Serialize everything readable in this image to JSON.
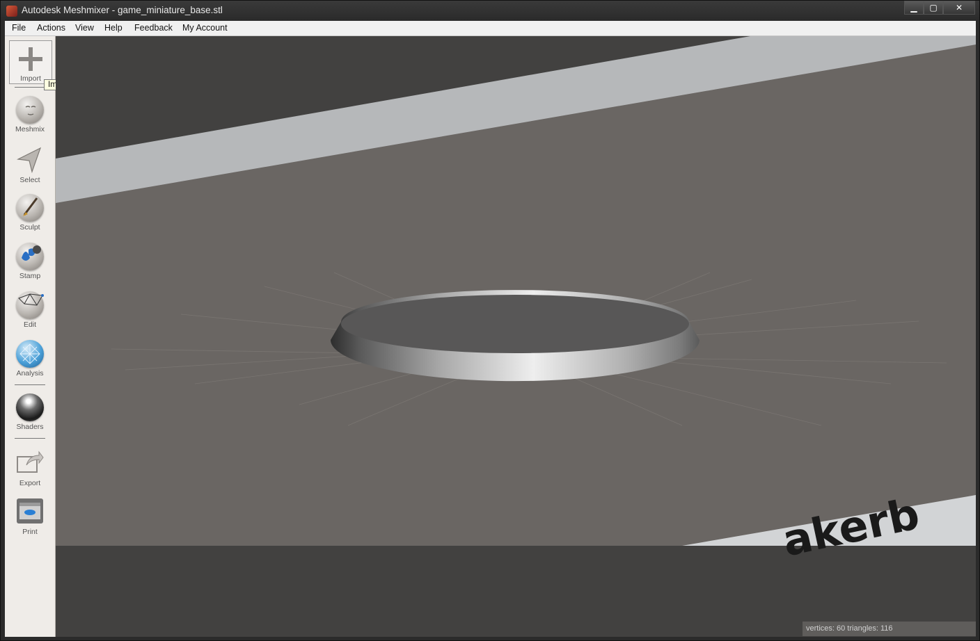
{
  "window": {
    "title": "Autodesk Meshmixer - game_miniature_base.stl",
    "buttons": {
      "minimize": "▁",
      "maximize": "▢",
      "close": "✕"
    }
  },
  "menu": {
    "items": [
      "File",
      "Actions",
      "View",
      "Help",
      "Feedback",
      "My Account"
    ]
  },
  "toolbar": {
    "tools": [
      {
        "label": "Import",
        "icon": "plus-icon"
      },
      {
        "label": "Meshmix",
        "icon": "face-ball-icon"
      },
      {
        "label": "Select",
        "icon": "arrow-icon"
      },
      {
        "label": "Sculpt",
        "icon": "brush-ball-icon"
      },
      {
        "label": "Stamp",
        "icon": "stamp-ball-icon"
      },
      {
        "label": "Edit",
        "icon": "mesh-ball-icon"
      },
      {
        "label": "Analysis",
        "icon": "analysis-ball-icon"
      },
      {
        "label": "Shaders",
        "icon": "shader-ball-icon"
      },
      {
        "label": "Export",
        "icon": "export-icon"
      },
      {
        "label": "Print",
        "icon": "printer-icon"
      }
    ]
  },
  "tooltip": "Import",
  "viewport": {
    "watermark_text": "akerb"
  },
  "status": "vertices: 60 triangles: 116",
  "colors": {
    "floor": "#6a6663",
    "stripe": "#b6b8ba",
    "background_dark": "#424140"
  }
}
